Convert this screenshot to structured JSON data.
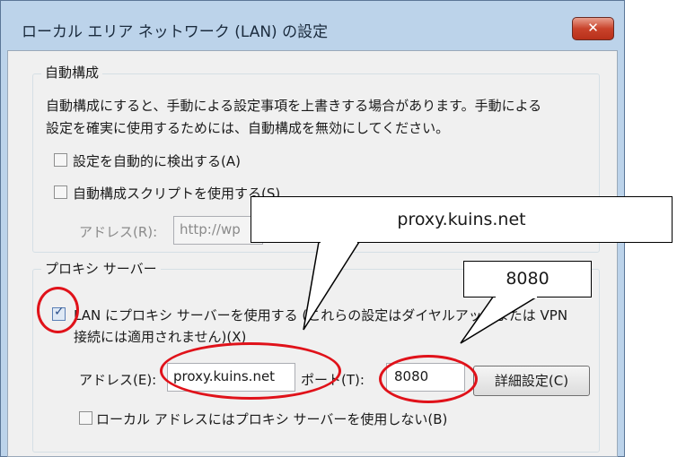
{
  "window": {
    "title": "ローカル エリア ネットワーク (LAN) の設定",
    "close_label": "✕"
  },
  "auto_config": {
    "legend": "自動構成",
    "description_line1": "自動構成にすると、手動による設定事項を上書きする場合があります。手動による",
    "description_line2": "設定を確実に使用するためには、自動構成を無効にしてください。",
    "auto_detect_label": "設定を自動的に検出する(A)",
    "auto_detect_checked": false,
    "script_label": "自動構成スクリプトを使用する(S)",
    "script_checked": false,
    "address_label": "アドレス(R):",
    "address_value": "http://wp"
  },
  "proxy": {
    "legend": "プロキシ サーバー",
    "use_proxy_line1": "LAN にプロキシ サーバーを使用する (これらの設定はダイヤルアップまたは VPN",
    "use_proxy_line2": "接続には適用されません)(X)",
    "use_proxy_checked": true,
    "address_label": "アドレス(E):",
    "address_value": "proxy.kuins.net",
    "port_label": "ポート(T):",
    "port_value": "8080",
    "advanced_label": "詳細設定(C)",
    "bypass_label": "ローカル アドレスにはプロキシ サーバーを使用しない(B)",
    "bypass_checked": false
  },
  "callouts": {
    "address_callout": "proxy.kuins.net",
    "port_callout": "8080"
  },
  "colors": {
    "highlight": "#e0121a",
    "titlebar": "#bcd3ea",
    "dialog_bg": "#f0f0f0"
  }
}
